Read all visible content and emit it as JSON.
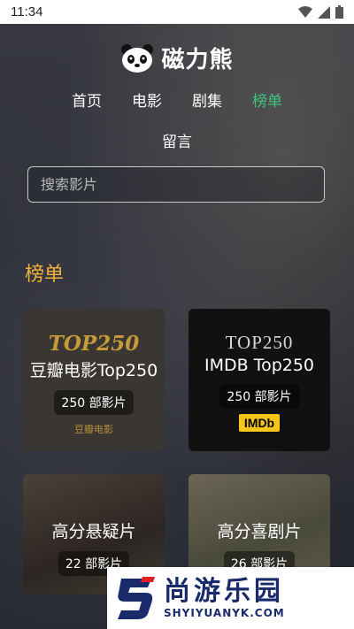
{
  "status_bar": {
    "time": "11:34"
  },
  "app": {
    "name": "磁力熊"
  },
  "nav": {
    "items": [
      {
        "label": "首页",
        "active": false
      },
      {
        "label": "电影",
        "active": false
      },
      {
        "label": "剧集",
        "active": false
      },
      {
        "label": "榜单",
        "active": true
      }
    ],
    "second_row": "留言"
  },
  "search": {
    "placeholder": "搜索影片"
  },
  "section": {
    "title": "榜单"
  },
  "cards": [
    {
      "badge": "TOP250",
      "title": "豆瓣电影Top250",
      "count": "250 部影片",
      "brand": "豆瓣电影"
    },
    {
      "badge": "TOP250",
      "title": "IMDB Top250",
      "count": "250 部影片",
      "brand": "IMDb"
    },
    {
      "title": "高分悬疑片",
      "count": "22 部影片"
    },
    {
      "title": "高分喜剧片",
      "count": "26 部影片"
    }
  ],
  "watermark": {
    "cn": "尚游乐园",
    "en": "SHYIYUANYK.COM"
  },
  "colors": {
    "accent_green": "#3ec47a",
    "section_gold": "#f2b23c",
    "imdb_yellow": "#f5c518"
  }
}
